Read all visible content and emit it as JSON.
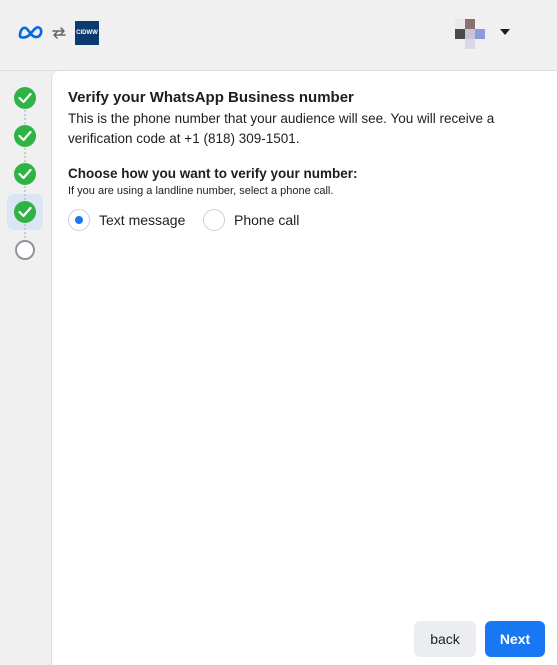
{
  "header": {
    "business_logo_text": "CIDWW",
    "brand_color": "#0b3a6e"
  },
  "stepper": {
    "steps": [
      {
        "status": "complete"
      },
      {
        "status": "complete"
      },
      {
        "status": "complete"
      },
      {
        "status": "complete",
        "current": true
      },
      {
        "status": "incomplete"
      }
    ]
  },
  "main": {
    "title": "Verify your WhatsApp Business number",
    "description": "This is the phone number that your audience will see. You will receive a verification code at +1 (818) 309-1501.",
    "choose_label": "Choose how you want to verify your number:",
    "choose_hint": "If you are using a landline number, select a phone call.",
    "options": [
      {
        "label": "Text message",
        "selected": true
      },
      {
        "label": "Phone call",
        "selected": false
      }
    ]
  },
  "footer": {
    "back_label": "back",
    "next_label": "Next"
  },
  "colors": {
    "accent": "#1877f2",
    "success": "#2fb344"
  }
}
